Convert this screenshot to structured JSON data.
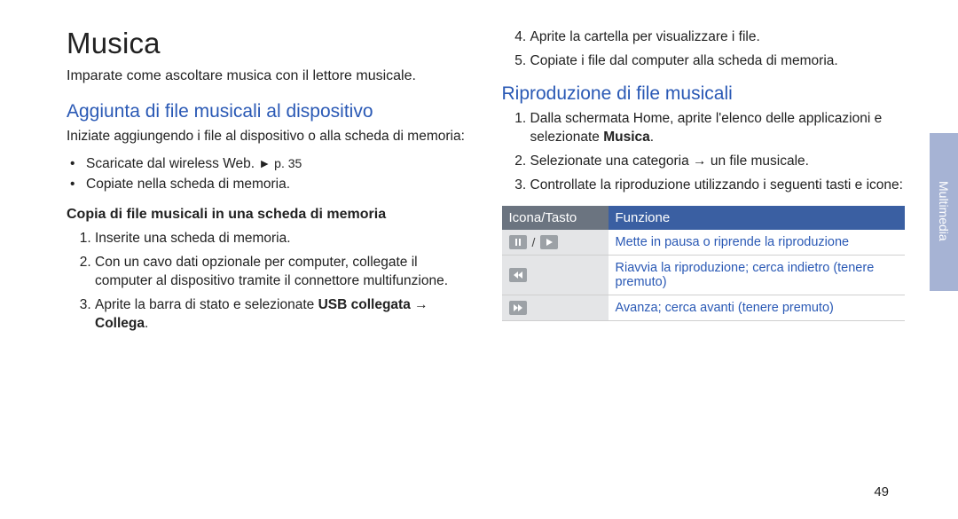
{
  "page_number": "49",
  "side_tab": "Multimedia",
  "left": {
    "title": "Musica",
    "intro": "Imparate come ascoltare musica con il lettore musicale.",
    "h2_add": "Aggiunta di file musicali al dispositivo",
    "add_intro": "Iniziate aggiungendo i file al dispositivo o alla scheda di memoria:",
    "bullet1_pre": "Scaricate dal wireless Web. ",
    "bullet1_arrow": "►",
    "bullet1_ref": " p. 35",
    "bullet2": "Copiate nella scheda di memoria.",
    "subhead": "Copia di file musicali in una scheda di memoria",
    "step1": "Inserite una scheda di memoria.",
    "step2": "Con un cavo dati opzionale per computer, collegate il computer al dispositivo tramite il connettore multifunzione.",
    "step3_pre": "Aprite la barra di stato e selezionate ",
    "step3_bold": "USB collegata → Collega",
    "step3_post": "."
  },
  "right": {
    "step4": "Aprite la cartella per visualizzare i file.",
    "step5": "Copiate i file dal computer alla scheda di memoria.",
    "h2_play": "Riproduzione di file musicali",
    "p1_pre": "Dalla schermata Home, aprite l'elenco delle applicazioni e selezionate ",
    "p1_bold": "Musica",
    "p1_post": ".",
    "p2": "Selezionate una categoria → un file musicale.",
    "p3": "Controllate la riproduzione utilizzando i seguenti tasti e icone:",
    "th1": "Icona/Tasto",
    "th2": "Funzione",
    "row1_func": "Mette in pausa o riprende la riproduzione",
    "row2_func": "Riavvia la riproduzione; cerca indietro (tenere premuto)",
    "row3_func": "Avanza; cerca avanti (tenere premuto)"
  }
}
